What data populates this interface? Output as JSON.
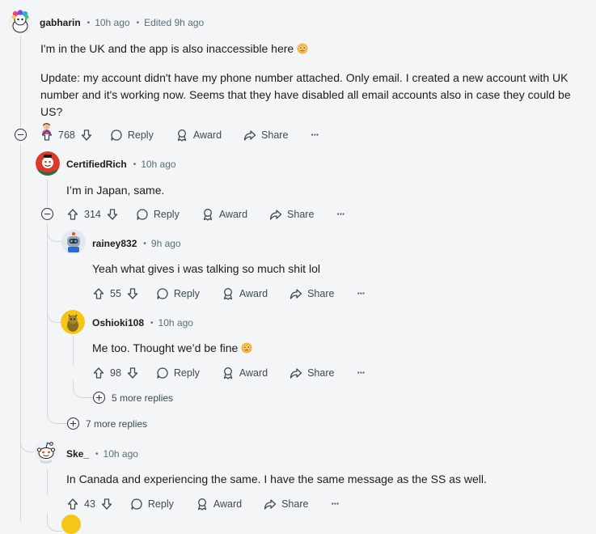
{
  "comments": [
    {
      "user": "gabharin",
      "time": "10h ago",
      "edited": "Edited 9h ago",
      "text1": "I'm in the UK and the app is also inaccessible here",
      "text2": "Update: my account didn't have my phone number attached. Only email. I created a new account with UK",
      "text3": "number and it's working now. Seems that they have disabled all email accounts also in case they could be US?",
      "votes": "768"
    },
    {
      "user": "CertifiedRich",
      "time": "10h ago",
      "text": "I’m in Japan, same.",
      "votes": "314"
    },
    {
      "user": "rainey832",
      "time": "9h ago",
      "text": "Yeah what gives i was talking so much shit lol",
      "votes": "55"
    },
    {
      "user": "Oshioki108",
      "time": "10h ago",
      "text": "Me too. Thought we’d be fine",
      "votes": "98"
    },
    {
      "user": "Ske_",
      "time": "10h ago",
      "text": "In Canada and experiencing the same. I have the same message as the SS as well.",
      "votes": "43"
    }
  ],
  "actions": {
    "reply": "Reply",
    "award": "Award",
    "share": "Share",
    "overflow": "···"
  },
  "more_replies": {
    "nested": "5 more replies",
    "level1": "7 more replies"
  },
  "icons": {
    "upvote": "upvote-icon",
    "downvote": "downvote-icon",
    "reply": "reply-bubble-icon",
    "award": "award-icon",
    "share": "share-icon",
    "more": "overflow-icon",
    "collapse": "collapse-icon",
    "expand": "expand-icon"
  },
  "colors": {
    "background": "#f4f5f7",
    "text": "#1c1c1c",
    "meta": "#576f76",
    "line": "#d4d7d9"
  }
}
